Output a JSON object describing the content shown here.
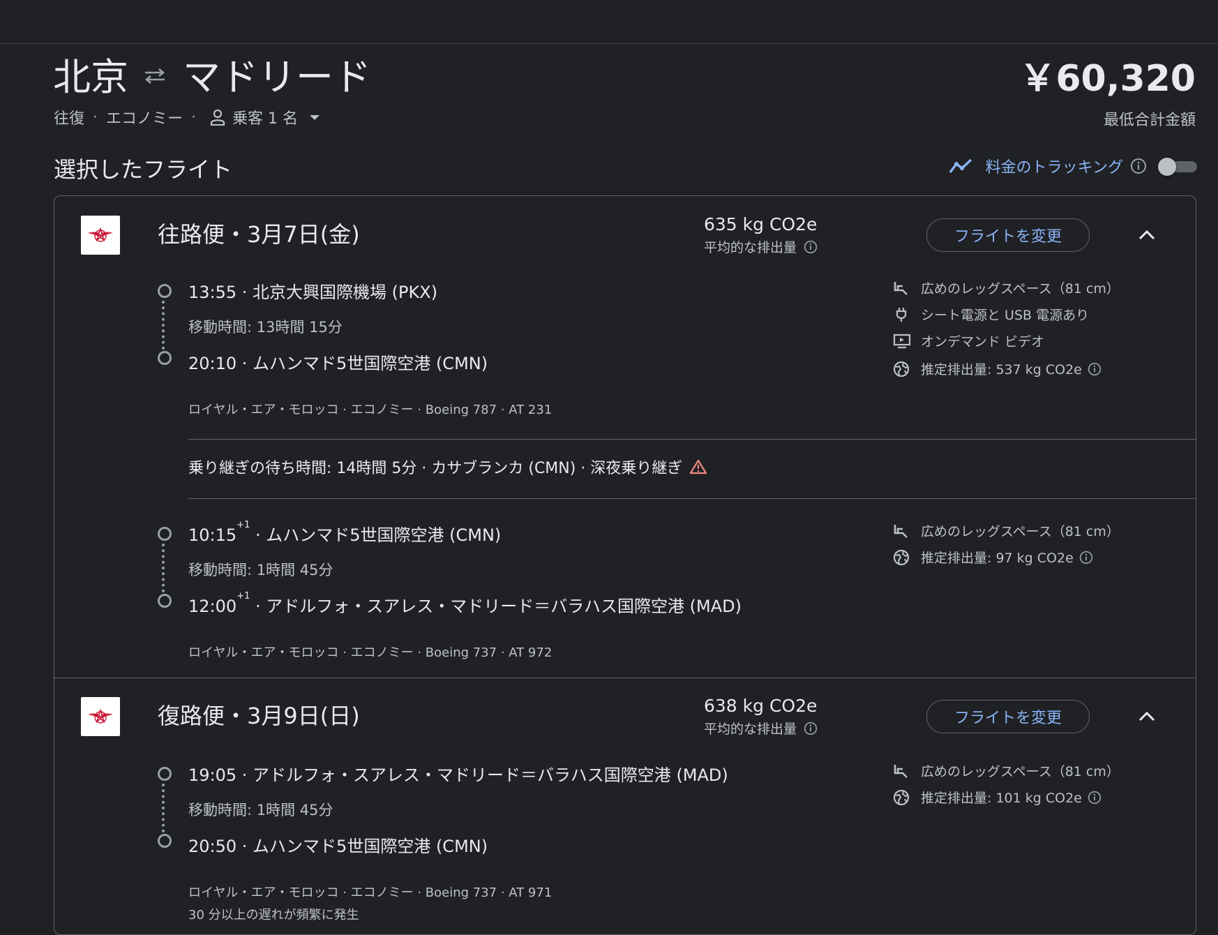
{
  "header": {
    "origin": "北京",
    "destination": "マドリード",
    "trip_type": "往復",
    "cabin": "エコノミー",
    "passengers": "乗客 1 名",
    "price": "￥60,320",
    "price_label": "最低合計金額"
  },
  "selected": {
    "title": "選択したフライト",
    "tracking_label": "料金のトラッキング",
    "tracking_on": false
  },
  "outbound": {
    "heading": "往路便・3月7日(金)",
    "co2": "635 kg CO2e",
    "co2_label": "平均的な排出量",
    "change_label": "フライトを変更",
    "seg1": {
      "dep": "13:55 · 北京大興国際機場 (PKX)",
      "duration": "移動時間: 13時間 15分",
      "arr": "20:10 · ムハンマド5世国際空港 (CMN)",
      "meta": "ロイヤル・エア・モロッコ · エコノミー · Boeing 787 · AT 231",
      "amenities": {
        "legroom": "広めのレッグスペース（81 cm）",
        "power": "シート電源と USB 電源あり",
        "video": "オンデマンド ビデオ",
        "emissions": "推定排出量: 537 kg CO2e"
      }
    },
    "layover": "乗り継ぎの待ち時間: 14時間 5分 · カサブランカ (CMN) · 深夜乗り継ぎ",
    "seg2": {
      "dep_time": "10:15",
      "dep_plus": "+1",
      "dep_place": " · ムハンマド5世国際空港 (CMN)",
      "duration": "移動時間: 1時間 45分",
      "arr_time": "12:00",
      "arr_plus": "+1",
      "arr_place": " · アドルフォ・スアレス・マドリード＝バラハス国際空港 (MAD)",
      "meta": "ロイヤル・エア・モロッコ · エコノミー · Boeing 737 · AT 972",
      "amenities": {
        "legroom": "広めのレッグスペース（81 cm）",
        "emissions": "推定排出量: 97 kg CO2e"
      }
    }
  },
  "return": {
    "heading": "復路便・3月9日(日)",
    "co2": "638 kg CO2e",
    "co2_label": "平均的な排出量",
    "change_label": "フライトを変更",
    "seg1": {
      "dep": "19:05 · アドルフォ・スアレス・マドリード＝バラハス国際空港 (MAD)",
      "duration": "移動時間: 1時間 45分",
      "arr": "20:50 · ムハンマド5世国際空港 (CMN)",
      "meta": "ロイヤル・エア・モロッコ · エコノミー · Boeing 737 · AT 971",
      "delay_note": "30 分以上の遅れが頻繁に発生",
      "amenities": {
        "legroom": "広めのレッグスペース（81 cm）",
        "emissions": "推定排出量: 101 kg CO2e"
      }
    }
  },
  "colors": {
    "background": "#202124",
    "accent": "#8ab4f8",
    "warning": "#f28b82",
    "airline_red": "#c8102e"
  }
}
